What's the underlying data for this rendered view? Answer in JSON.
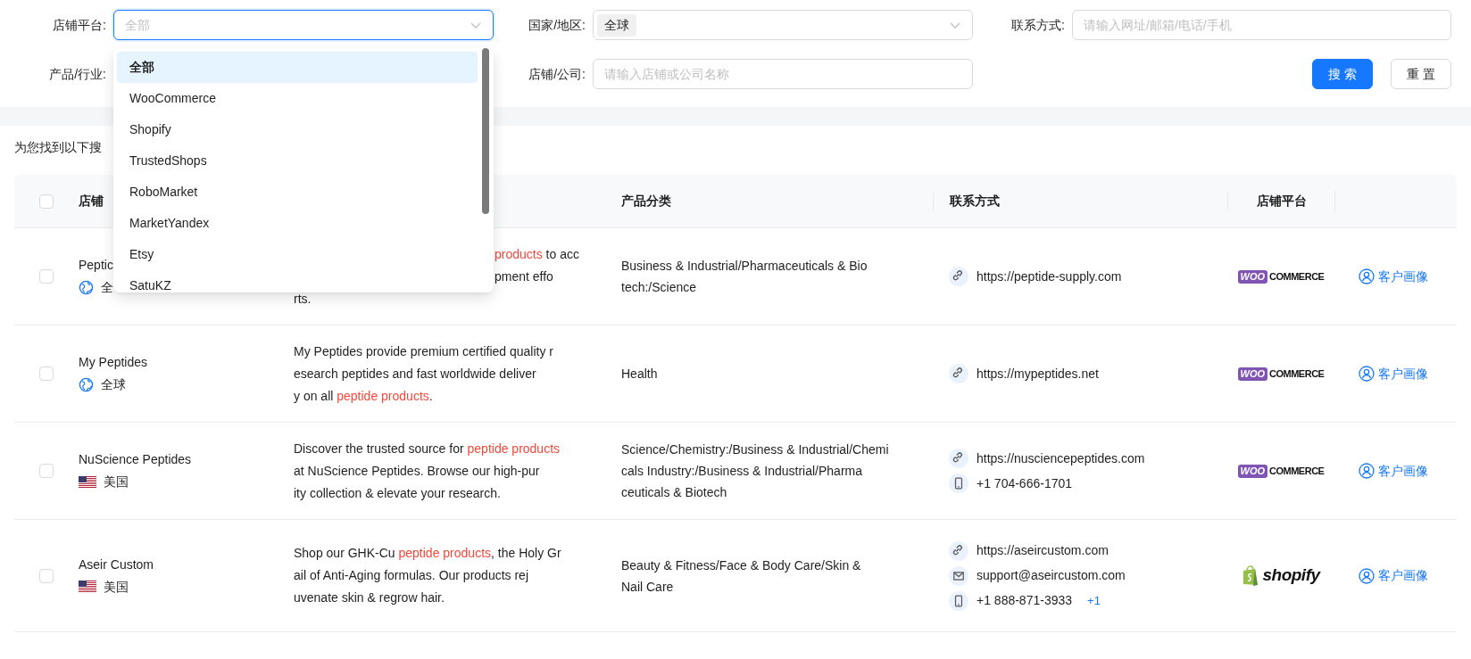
{
  "filters": [
    {
      "label": "店铺平台:",
      "kind": "select",
      "placeholder": "全部",
      "focused": true
    },
    {
      "label": "国家/地区:",
      "kind": "select",
      "tag": "全球",
      "focused": false
    },
    {
      "label": "联系方式:",
      "kind": "input",
      "placeholder": "请输入网址/邮箱/电话/手机"
    },
    {
      "label": "产品/行业:",
      "kind": "covered"
    },
    {
      "label": "店铺/公司:",
      "kind": "input",
      "placeholder": "请输入店铺或公司名称"
    }
  ],
  "buttons": [
    {
      "label": "搜 索",
      "kind": "primary"
    },
    {
      "label": "重 置",
      "kind": "default"
    }
  ],
  "dropdown": {
    "open": true,
    "options": [
      {
        "label": "全部",
        "selected": true
      },
      {
        "label": "WooCommerce",
        "selected": false
      },
      {
        "label": "Shopify",
        "selected": false
      },
      {
        "label": "TrustedShops",
        "selected": false
      },
      {
        "label": "RoboMarket",
        "selected": false
      },
      {
        "label": "MarketYandex",
        "selected": false
      },
      {
        "label": "Etsy",
        "selected": false
      },
      {
        "label": "SatuKZ",
        "selected": false
      }
    ]
  },
  "result_label": "为您找到以下搜",
  "table": {
    "header": {
      "checked": false,
      "name": "店铺",
      "category": "产品分类",
      "contact": "联系方式",
      "platform": "店铺平台"
    },
    "rows": [
      {
        "checked": false,
        "name": "Peptic",
        "region": {
          "kind": "globe",
          "label": "全"
        },
        "description": [
          [
            {
              "text": "products",
              "highlight": true
            },
            {
              "text": " to acc",
              "highlight": false
            }
          ],
          [
            {
              "text": "pment effo",
              "highlight": false
            }
          ],
          [
            {
              "text": "rts.",
              "highlight": false
            }
          ]
        ],
        "category": [
          "Business & Industrial/Pharmaceuticals & Bio",
          "tech:/Science"
        ],
        "contacts": [
          {
            "kind": "link",
            "text": "https://peptide-supply.com"
          }
        ],
        "platform": {
          "kind": "woocommerce",
          "mark": "WOO",
          "word": "COMMERCE"
        },
        "action": "客户画像"
      },
      {
        "checked": false,
        "name": "My Peptides",
        "region": {
          "kind": "globe",
          "label": "全球"
        },
        "description": [
          [
            {
              "text": "My Peptides provide premium certified quality r",
              "highlight": false
            }
          ],
          [
            {
              "text": "esearch peptides and fast worldwide deliver",
              "highlight": false
            }
          ],
          [
            {
              "text": "y on all ",
              "highlight": false
            },
            {
              "text": "peptide products",
              "highlight": true
            },
            {
              "text": ".",
              "highlight": false
            }
          ]
        ],
        "category": [
          "Health"
        ],
        "contacts": [
          {
            "kind": "link",
            "text": "https://mypeptides.net"
          }
        ],
        "platform": {
          "kind": "woocommerce",
          "mark": "WOO",
          "word": "COMMERCE"
        },
        "action": "客户画像"
      },
      {
        "checked": false,
        "name": "NuScience Peptides",
        "region": {
          "kind": "us_flag",
          "label": "美国"
        },
        "description": [
          [
            {
              "text": "Discover the trusted source for ",
              "highlight": false
            },
            {
              "text": "peptide products",
              "highlight": true
            }
          ],
          [
            {
              "text": "at NuScience Peptides. Browse our high-pur",
              "highlight": false
            }
          ],
          [
            {
              "text": "ity collection & elevate your research.",
              "highlight": false
            }
          ]
        ],
        "category": [
          "Science/Chemistry:/Business & Industrial/Chemi",
          "cals Industry:/Business & Industrial/Pharma",
          "ceuticals & Biotech"
        ],
        "contacts": [
          {
            "kind": "link",
            "text": "https://nusciencepeptides.com"
          },
          {
            "kind": "phone",
            "text": "+1 704-666-1701"
          }
        ],
        "platform": {
          "kind": "woocommerce",
          "mark": "WOO",
          "word": "COMMERCE"
        },
        "action": "客户画像"
      },
      {
        "checked": false,
        "name": "Aseir Custom",
        "region": {
          "kind": "us_flag",
          "label": "美国"
        },
        "description": [
          [
            {
              "text": "Shop our GHK-Cu ",
              "highlight": false
            },
            {
              "text": "peptide products",
              "highlight": true
            },
            {
              "text": ", the Holy Gr",
              "highlight": false
            }
          ],
          [
            {
              "text": "ail of Anti-Aging formulas. Our products rej",
              "highlight": false
            }
          ],
          [
            {
              "text": "uvenate skin & regrow hair.",
              "highlight": false
            }
          ]
        ],
        "category": [
          "Beauty & Fitness/Face & Body Care/Skin &",
          "Nail Care"
        ],
        "contacts": [
          {
            "kind": "link",
            "text": "https://aseircustom.com"
          },
          {
            "kind": "email",
            "text": "support@aseircustom.com"
          },
          {
            "kind": "phone",
            "text": "+1 888-871-3933",
            "more": "+1"
          }
        ],
        "platform": {
          "kind": "shopify",
          "word": "shopify"
        },
        "action": "客户画像"
      }
    ]
  }
}
